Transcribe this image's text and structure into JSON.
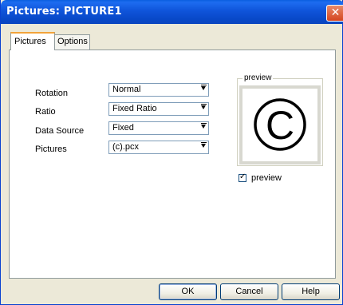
{
  "window": {
    "title": "Pictures: PICTURE1",
    "close_glyph": "✕"
  },
  "tabs": [
    {
      "label": "Pictures",
      "active": true
    },
    {
      "label": "Options",
      "active": false
    }
  ],
  "fields": [
    {
      "label": "Rotation",
      "value": "Normal"
    },
    {
      "label": "Ratio",
      "value": "Fixed Ratio"
    },
    {
      "label": "Data Source",
      "value": "Fixed"
    },
    {
      "label": "Pictures",
      "value": "(c).pcx"
    }
  ],
  "preview": {
    "group_label": "preview",
    "image_text": "C",
    "checkbox_label": "preview",
    "checkbox_checked": true,
    "check_glyph": "✓"
  },
  "buttons": {
    "ok": "OK",
    "cancel": "Cancel",
    "help": "Help"
  },
  "colors": {
    "title_bar": "#0a54d6",
    "active_tab_accent": "#f2a33a",
    "close_button": "#d5451f"
  }
}
